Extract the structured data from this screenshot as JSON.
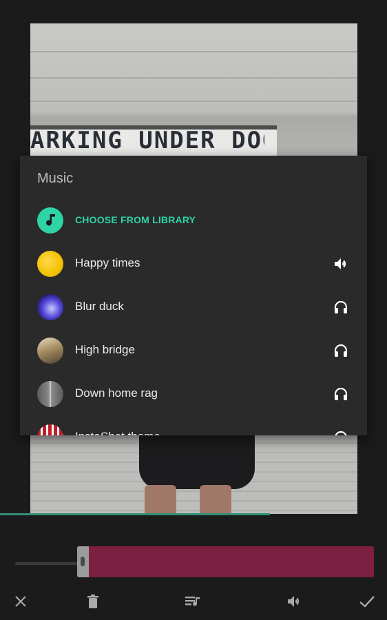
{
  "background": {
    "sign_text": "ARKING UNDER DOOR"
  },
  "dialog": {
    "title": "Music",
    "library_label": "CHOOSE FROM LIBRARY",
    "tracks": [
      {
        "label": "Happy times",
        "action_icon": "volume-icon",
        "thumb_color": "#f2c200"
      },
      {
        "label": "Blur duck",
        "action_icon": "headphones-icon",
        "thumb_color": "#3b2fb0"
      },
      {
        "label": "High bridge",
        "action_icon": "headphones-icon",
        "thumb_color": "#8a7a5a"
      },
      {
        "label": "Down home rag",
        "action_icon": "headphones-icon",
        "thumb_color": "#777777"
      },
      {
        "label": "InstaShot theme",
        "action_icon": "headphones-icon",
        "thumb_color": "#c01f2c"
      }
    ]
  },
  "colors": {
    "accent": "#2ed3a6",
    "clip": "#7d1f40",
    "progress": "#2f8f77"
  },
  "toolbar": {
    "icons": [
      "close-icon",
      "trash-icon",
      "playlist-icon",
      "volume-icon",
      "check-icon"
    ]
  }
}
